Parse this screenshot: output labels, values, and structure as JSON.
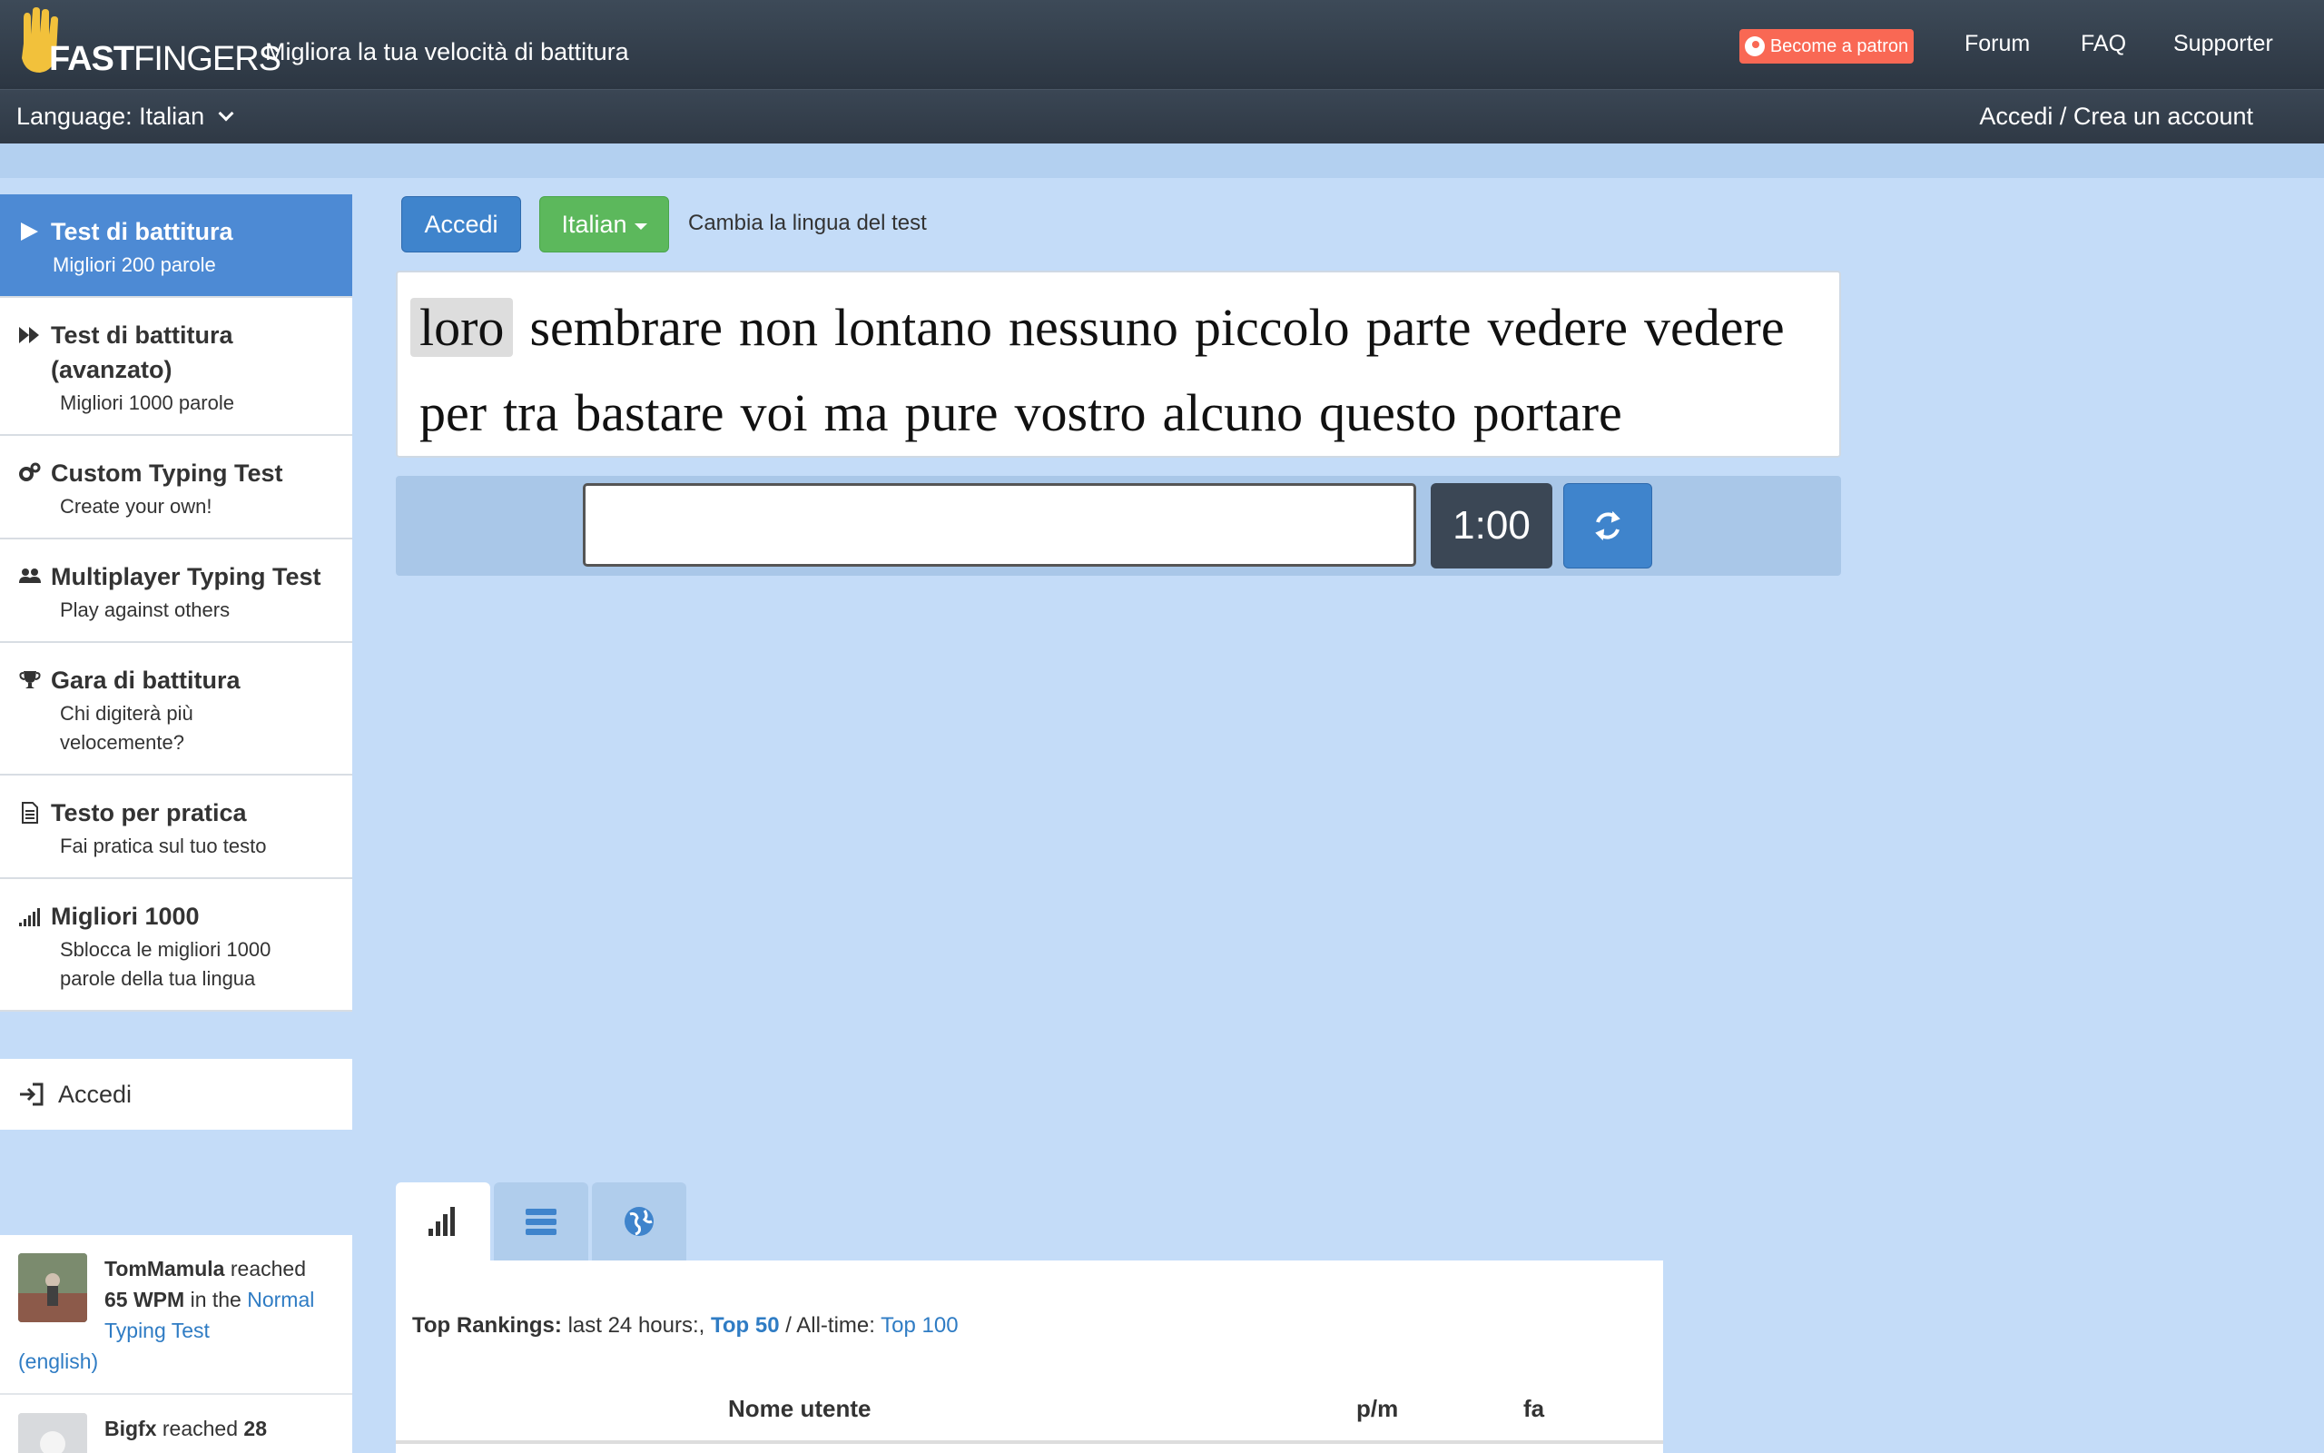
{
  "header": {
    "logo_text_bold": "FAST",
    "logo_text_light": "FINGERS",
    "tagline": "Migliora la tua velocità di battitura",
    "patron_label": "Become a patron",
    "nav": [
      "Forum",
      "FAQ",
      "Supporter"
    ],
    "language_label": "Language: Italian",
    "login_link": "Accedi / Crea un account"
  },
  "sidebar": {
    "items": [
      {
        "title": "Test di battitura",
        "sub": "Migliori 200 parole",
        "icon": "play-icon",
        "active": true
      },
      {
        "title": "Test di battitura (avanzato)",
        "sub": "Migliori 1000 parole",
        "icon": "fast-forward-icon"
      },
      {
        "title": "Custom Typing Test",
        "sub": "Create your own!",
        "icon": "gears-icon"
      },
      {
        "title": "Multiplayer Typing Test",
        "sub": "Play against others",
        "icon": "users-icon"
      },
      {
        "title": "Gara di battitura",
        "sub": "Chi digiterà più velocemente?",
        "icon": "trophy-icon"
      },
      {
        "title": "Testo per pratica",
        "sub": "Fai pratica sul tuo testo",
        "icon": "document-icon"
      },
      {
        "title": "Migliori 1000",
        "sub": "Sblocca le migliori 1000 parole della tua lingua",
        "icon": "signal-icon"
      }
    ],
    "login_label": "Accedi"
  },
  "feed": {
    "items": [
      {
        "user": "TomMamula",
        "reached": "reached",
        "wpm": "65 WPM",
        "in_the": "in the",
        "test": "Normal Typing Test",
        "lang": "(english)"
      },
      {
        "user": "Bigfx",
        "reached": "reached",
        "wpm": "28"
      }
    ]
  },
  "controls": {
    "accedi_label": "Accedi",
    "language_button": "Italian",
    "change_language_text": "Cambia la lingua del test",
    "input_value": "",
    "timer": "1:00"
  },
  "words": {
    "current": "loro",
    "line1": [
      "sembrare",
      "non",
      "lontano",
      "nessuno",
      "piccolo",
      "parte",
      "vedere",
      "vedere"
    ],
    "line2": [
      "per",
      "tra",
      "bastare",
      "voi",
      "ma",
      "pure",
      "vostro",
      "alcuno",
      "questo",
      "portare"
    ]
  },
  "rankings": {
    "label": "Top Rankings:",
    "last24": "last 24 hours:,",
    "top50": "Top 50",
    "sep": "/ All-time:",
    "top100": "Top 100",
    "columns": [
      "Nome utente",
      "p/m",
      "fa"
    ]
  },
  "colors": {
    "background": "#c4dcf8",
    "navbar": "#2f3945",
    "primary": "#3f84cc",
    "success": "#5cb85c",
    "patron": "#f96854",
    "timer": "#3b4755"
  }
}
